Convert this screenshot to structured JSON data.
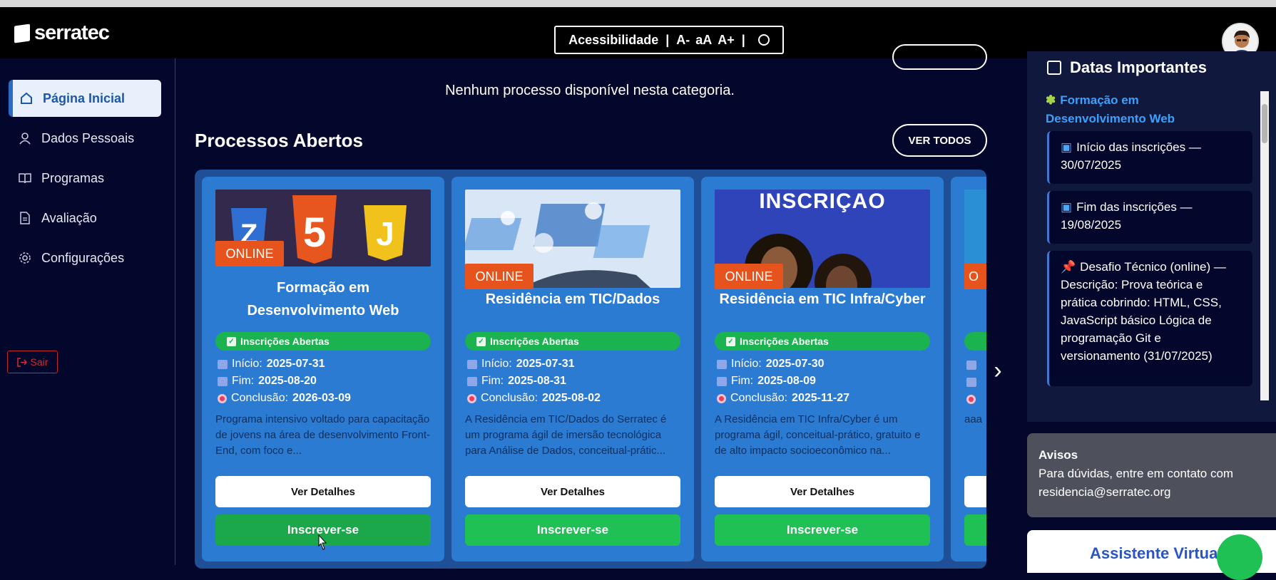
{
  "header": {
    "logo_text": "serratec",
    "accessibility": {
      "label": "Acessibilidade",
      "decrease": "A-",
      "normal": "aA",
      "increase": "A+"
    }
  },
  "sidebar": {
    "items": [
      {
        "label": "Página Inicial",
        "icon": "home-icon",
        "active": true
      },
      {
        "label": "Dados Pessoais",
        "icon": "user-icon",
        "active": false
      },
      {
        "label": "Programas",
        "icon": "book-icon",
        "active": false
      },
      {
        "label": "Avaliação",
        "icon": "document-icon",
        "active": false
      },
      {
        "label": "Configurações",
        "icon": "gear-icon",
        "active": false
      }
    ],
    "logout_label": "Sair"
  },
  "main": {
    "empty_message": "Nenhum processo disponível nesta categoria.",
    "section_title": "Processos Abertos",
    "see_all_label": "VER TODOS",
    "cards": [
      {
        "badge": "ONLINE",
        "title_line1": "Formação em",
        "title_line2": "Desenvolvimento Web",
        "status": "Inscrições Abertas",
        "start_label": "Início:",
        "start": "2025-07-31",
        "end_label": "Fim:",
        "end": "2025-08-20",
        "conclusion_label": "Conclusão:",
        "conclusion": "2026-03-09",
        "description": "Programa intensivo voltado para capacitação de jovens na área de desenvolvimento Front-End, com foco e...",
        "details_label": "Ver Detalhes",
        "subscribe_label": "Inscrever-se"
      },
      {
        "badge": "ONLINE",
        "title_line1": "Residência em TIC/Dados",
        "title_line2": "",
        "status": "Inscrições Abertas",
        "start_label": "Início:",
        "start": "2025-07-31",
        "end_label": "Fim:",
        "end": "2025-08-31",
        "conclusion_label": "Conclusão:",
        "conclusion": "2025-08-02",
        "description": "A Residência em TIC/Dados do Serratec é um programa ágil de imersão tecnológica para Análise de Dados, conceitual-prátic...",
        "details_label": "Ver Detalhes",
        "subscribe_label": "Inscrever-se"
      },
      {
        "badge": "ONLINE",
        "image_text": "INSCRIÇAO",
        "title_line1": "Residência em TIC Infra/Cyber",
        "title_line2": "",
        "status": "Inscrições Abertas",
        "start_label": "Início:",
        "start": "2025-07-30",
        "end_label": "Fim:",
        "end": "2025-08-09",
        "conclusion_label": "Conclusão:",
        "conclusion": "2025-11-27",
        "description": "A Residência em TIC Infra/Cyber é um programa ágil, conceitual-prático, gratuito e de alto impacto socioeconômico na...",
        "details_label": "Ver Detalhes",
        "subscribe_label": "Inscrever-se"
      }
    ],
    "partial_card": {
      "badge": "O",
      "description": "aaa"
    }
  },
  "right_panel": {
    "dates_title": "Datas Importantes",
    "program_name": "Formação em Desenvolvimento Web",
    "dates": [
      {
        "text": "Início das inscrições — 30/07/2025"
      },
      {
        "text": "Fim das inscrições — 19/08/2025"
      },
      {
        "text": "Desafio Técnico (online) — Descrição: Prova teórica e prática cobrindo: HTML, CSS, JavaScript básico Lógica de programação Git e versionamento (31/07/2025)"
      }
    ],
    "notices_title": "Avisos",
    "notices_text": "Para dúvidas, entre em contato com residencia@serratec.org",
    "assistant_title": "Assistente Virtual"
  },
  "colors": {
    "background": "#03072b",
    "card": "#2c7bd2",
    "carousel": "#1f4f97",
    "online_badge": "#e6531d",
    "status_green": "#1bb34f",
    "subscribe_green": "#1fc155",
    "link_blue": "#3aa1ff",
    "logout_red": "#d32f2f"
  }
}
